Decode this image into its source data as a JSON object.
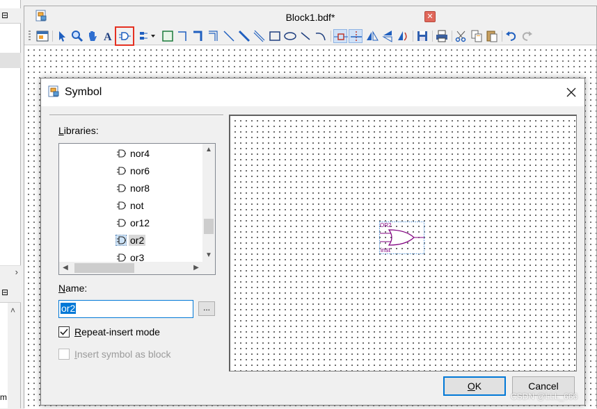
{
  "left_panel": {
    "top_bar_glyph": "⊟",
    "bottom_bar_glyph": "⊟",
    "bottom_edge_text": "m"
  },
  "document": {
    "title": "Block1.bdf*",
    "close_glyph": "✕"
  },
  "dialog": {
    "title": "Symbol",
    "libraries_label_access": "L",
    "libraries_label_rest": "ibraries:",
    "libraries": [
      {
        "name": "nor4",
        "selected": false
      },
      {
        "name": "nor6",
        "selected": false
      },
      {
        "name": "nor8",
        "selected": false
      },
      {
        "name": "not",
        "selected": false
      },
      {
        "name": "or12",
        "selected": false
      },
      {
        "name": "or2",
        "selected": true
      },
      {
        "name": "or3",
        "selected": false
      }
    ],
    "name_label_access": "N",
    "name_label_rest": "ame:",
    "name_value": "or2",
    "browse_label": "...",
    "repeat_insert_access": "R",
    "repeat_insert_rest": "epeat-insert mode",
    "repeat_insert_checked": true,
    "insert_block_access": "I",
    "insert_block_rest": "nsert symbol as block",
    "insert_block_enabled": false,
    "preview": {
      "symbol_type": "OR2",
      "instance_label": "inst"
    },
    "ok_access": "O",
    "ok_rest": "K",
    "cancel_label": "Cancel"
  },
  "watermark": "CSDN @LLL_666",
  "colors": {
    "accent": "#0078d7",
    "symbol": "#800080",
    "highlight": "#e53021"
  }
}
